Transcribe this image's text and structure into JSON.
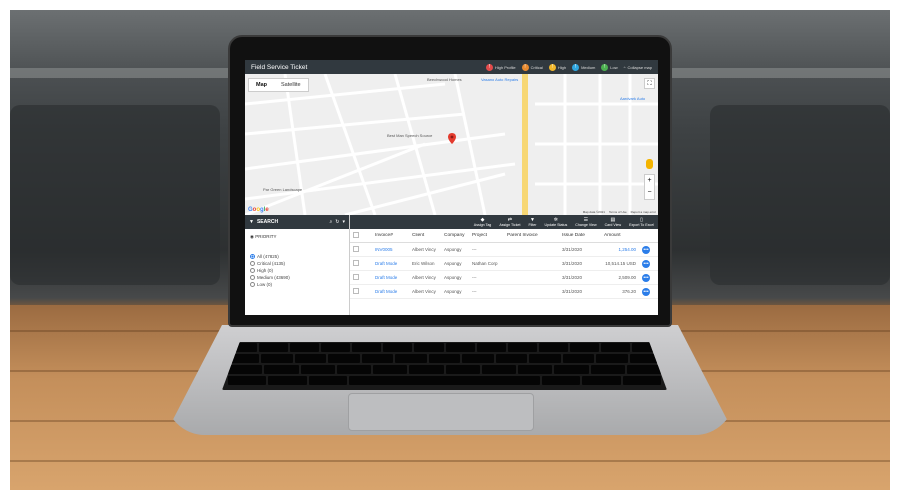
{
  "app": {
    "title": "Field Service Ticket"
  },
  "legend": [
    {
      "label": "High Profile",
      "color": "#e34b4b",
      "glyph": "!"
    },
    {
      "label": "Critical",
      "color": "#e98a2e",
      "glyph": "!"
    },
    {
      "label": "High",
      "color": "#f2b82c",
      "glyph": "!"
    },
    {
      "label": "Medium",
      "color": "#2fa6e0",
      "glyph": "!"
    },
    {
      "label": "Low",
      "color": "#4cb050",
      "glyph": "!"
    }
  ],
  "collapse_label": "Collapse map",
  "map": {
    "tabs": [
      "Map",
      "Satellite"
    ],
    "labels": [
      "Beechwood Homes",
      "Vasano Auto Repairs",
      "Best Man Speech Source",
      "Par Green Landscape",
      "Aardvark Auto"
    ],
    "attribution": [
      "Map data ©2021",
      "Terms of Use",
      "Report a map error"
    ]
  },
  "sidebar": {
    "search_label": "SEARCH",
    "priority_label": "PRIORITY",
    "options": [
      {
        "label": "All (47825)",
        "selected": true
      },
      {
        "label": "Critical (4135)",
        "selected": false
      },
      {
        "label": "High (0)",
        "selected": false
      },
      {
        "label": "Medium (43690)",
        "selected": false
      },
      {
        "label": "Low (0)",
        "selected": false
      }
    ]
  },
  "toolbar": [
    "Assign Tag",
    "Assign Ticket",
    "Filter",
    "Update Status",
    "Change View",
    "Card View",
    "Export To Excel"
  ],
  "grid": {
    "columns": [
      "Invoice#",
      "Client",
      "Company",
      "Project",
      "Parent Invoice",
      "Issue Date",
      "Amount"
    ],
    "rows": [
      {
        "invoice": "INV0005",
        "client": "Albert Vincy",
        "company": "Aspongy",
        "project": "---",
        "parent": "",
        "date": "3/31/2020",
        "amount": "1,254.00"
      },
      {
        "invoice": "Draft Mode",
        "client": "Eric Wilson",
        "company": "Aspongy",
        "project": "Nathan Corp",
        "parent": "",
        "date": "3/31/2020",
        "amount": "10,514.15 USD"
      },
      {
        "invoice": "Draft Mode",
        "client": "Albert Vincy",
        "company": "Aspongy",
        "project": "---",
        "parent": "",
        "date": "3/31/2020",
        "amount": "2,509.00"
      },
      {
        "invoice": "Draft Mode",
        "client": "Albert Vincy",
        "company": "Aspongy",
        "project": "---",
        "parent": "",
        "date": "3/31/2020",
        "amount": "376.20"
      }
    ]
  }
}
